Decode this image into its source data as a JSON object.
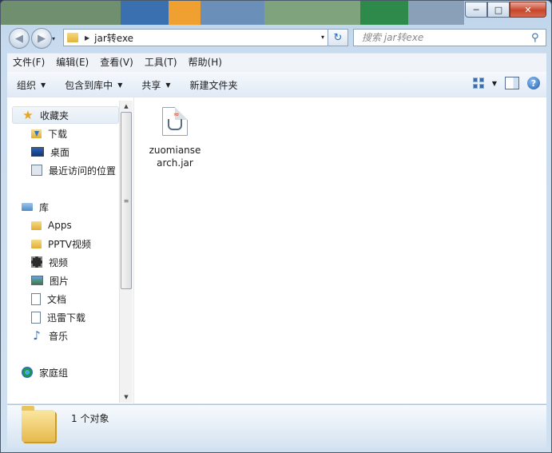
{
  "window": {
    "caption_buttons": {
      "minimize": "─",
      "maximize": "□",
      "close": "✕"
    }
  },
  "address": {
    "back_glyph": "◀",
    "forward_glyph": "▶",
    "dropdown_glyph": "▾",
    "path": "jar转exe",
    "refresh_glyph": "↻"
  },
  "search": {
    "placeholder": "搜索 jar转exe"
  },
  "menubar": {
    "items": [
      "文件(F)",
      "编辑(E)",
      "查看(V)",
      "工具(T)",
      "帮助(H)"
    ]
  },
  "commandbar": {
    "organize": "组织",
    "include_in_library": "包含到库中",
    "share": "共享",
    "new_folder": "新建文件夹",
    "help_glyph": "?"
  },
  "navpane": {
    "favorites": "收藏夹",
    "downloads": "下载",
    "desktop": "桌面",
    "recent": "最近访问的位置",
    "libraries": "库",
    "apps": "Apps",
    "pptv": "PPTV视频",
    "videos": "视频",
    "pictures": "图片",
    "documents": "文档",
    "xunlei": "迅雷下载",
    "music": "音乐",
    "homegroup": "家庭组"
  },
  "files": [
    {
      "name": "zuomiansearch.jar"
    }
  ],
  "details": {
    "status": "1 个对象"
  },
  "colors": {
    "frame": "#c9dbee",
    "close_button": "#c8452a",
    "accent": "#2c6db3"
  }
}
